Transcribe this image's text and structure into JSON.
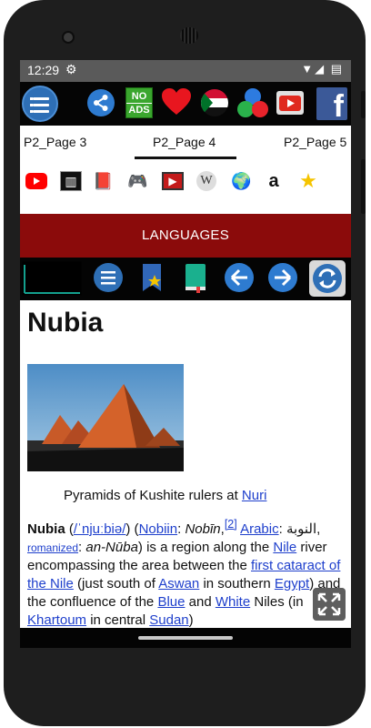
{
  "status_bar": {
    "time": "12:29",
    "gear_icon": "gear-icon",
    "right_icons": "▼◢ ▤"
  },
  "toolbar": {
    "icons": [
      "menu-icon",
      "share-icon",
      "no-ads-icon",
      "heart-icon",
      "sudan-flag-icon",
      "colors-icon",
      "video-icon",
      "facebook-icon"
    ],
    "no_ads_top": "NO",
    "no_ads_bottom": "ADS",
    "facebook_letter": "f"
  },
  "tabs": {
    "left": "P2_Page 3",
    "center": "P2_Page 4",
    "right": "P2_Page 5"
  },
  "icon_row": {
    "youtube": "▶",
    "film": "▥",
    "book": "📕",
    "gamepad": "🎮",
    "video": "▶",
    "wikipedia": "W",
    "globe": "🌍",
    "amazon": "a",
    "star": "★"
  },
  "banner": {
    "label": "LANGUAGES"
  },
  "article": {
    "title": "Nubia",
    "caption_text": "Pyramids of Kushite rulers at ",
    "caption_link": "Nuri",
    "p1_bold": "Nubia",
    "p1_a": " (",
    "p1_ipa": "/ˈnjuːbiə/",
    "p1_b": ") (",
    "p1_nobiin": "Nobiin",
    "p1_c": ": ",
    "p1_nobin": "Nobīn",
    "p1_c2": ",",
    "p1_ref": "[2]",
    "p1_d": " ",
    "p1_arabic": "Arabic",
    "p1_e": ": النوبة‎,",
    "p1_romanized": "romanized",
    "p1_f": ": ",
    "p1_annuba": "an-Nūba",
    "p1_g": ") is a region along the ",
    "p1_nile": "Nile",
    "p1_h": " river encompassing the area between the ",
    "p1_cataract": "first cataract of the Nile",
    "p1_i": " (just south of ",
    "p1_aswan": "Aswan",
    "p1_j": " in southern ",
    "p1_egypt": "Egypt",
    "p1_k": ") and the confluence of the ",
    "p1_blue": "Blue",
    "p1_l": " and ",
    "p1_white": "White",
    "p1_m": " Niles (in ",
    "p1_khartoum": "Khartoum",
    "p1_n": " in central ",
    "p1_sudan": "Sudan",
    "p1_o": ")"
  },
  "colors": {
    "banner": "#8b0b0b",
    "link": "#1e3fcc",
    "status_bar": "#5a5a5a",
    "accent_blue": "#2e6fb6"
  }
}
